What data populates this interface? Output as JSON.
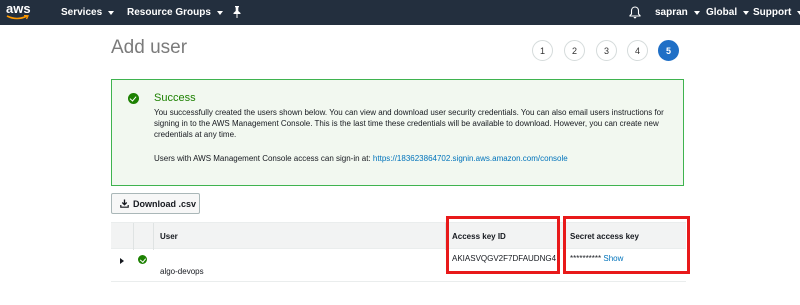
{
  "nav": {
    "logo_text": "aws",
    "services_label": "Services",
    "resource_groups_label": "Resource Groups",
    "pin_icon": "pin-icon",
    "bell_icon": "bell-icon",
    "user_label": "sapran",
    "region_label": "Global",
    "support_label": "Support"
  },
  "page": {
    "title": "Add user",
    "steps": [
      "1",
      "2",
      "3",
      "4",
      "5"
    ],
    "active_step": "5"
  },
  "success": {
    "title": "Success",
    "message": "You successfully created the users shown below. You can view and download user security credentials. You can also email users instructions for signing in to the AWS Management Console. This is the last time these credentials will be available to download. However, you can create new credentials at any time.",
    "signin_prefix": "Users with AWS Management Console access can sign-in at: ",
    "signin_url": "https://183623864702.signin.aws.amazon.com/console"
  },
  "download": {
    "label": "Download .csv",
    "icon": "download-icon"
  },
  "table": {
    "headers": {
      "user": "User",
      "access_key_id": "Access key ID",
      "secret_access_key": "Secret access key"
    },
    "rows": [
      {
        "user": "algo-devops",
        "access_key_id": "AKIASVQGV2F7DFAUDNG4",
        "secret_mask": "**********",
        "show_label": "Show"
      }
    ]
  },
  "colors": {
    "nav_bg": "#232f3e",
    "success_border": "#3fb34f",
    "success_green": "#1d8102",
    "link_blue": "#0073bb",
    "active_step": "#1f6fc6",
    "highlight_red": "#e8191a"
  }
}
